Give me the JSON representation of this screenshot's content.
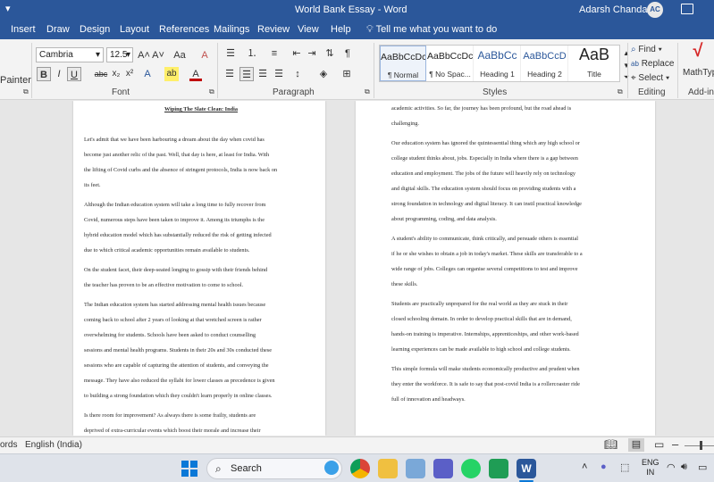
{
  "window": {
    "title": "World Bank Essay  -  Word",
    "user_name": "Adarsh Chandar",
    "user_initials": "AC"
  },
  "tabs": [
    "Insert",
    "Draw",
    "Design",
    "Layout",
    "References",
    "Mailings",
    "Review",
    "View",
    "Help"
  ],
  "tell_me": "Tell me what you want to do",
  "ribbon": {
    "clipboard": {
      "painter_label": "Painter"
    },
    "font": {
      "group_label": "Font",
      "font_name": "Cambria",
      "font_size": "12.5",
      "bold": "B",
      "italic": "I",
      "underline": "U",
      "strike": "abc",
      "subscript": "x₂",
      "superscript": "x²",
      "grow": "A˄",
      "shrink": "A˅",
      "case": "Aa",
      "clear": "A",
      "text_effects": "A",
      "highlight": "ab",
      "font_color": "A"
    },
    "paragraph": {
      "group_label": "Paragraph"
    },
    "styles": {
      "group_label": "Styles",
      "items": [
        {
          "sample": "AaBbCcDc",
          "name": "¶ Normal"
        },
        {
          "sample": "AaBbCcDc",
          "name": "¶ No Spac..."
        },
        {
          "sample": "AaBbCc",
          "name": "Heading 1"
        },
        {
          "sample": "AaBbCcD",
          "name": "Heading 2"
        },
        {
          "sample": "AaB",
          "name": "Title"
        }
      ]
    },
    "editing": {
      "group_label": "Editing",
      "find": "Find",
      "replace": "Replace",
      "select": "Select"
    },
    "addins": {
      "group_label": "Add-in",
      "mathtype": "MathType"
    }
  },
  "document": {
    "page1": {
      "heading": "Wiping The Slate Clean: India",
      "paragraphs": [
        [
          "Let's admit that we have been harbouring a dream about the day when covid has",
          "become just another relic of the past. Well, that day is here, at least for India. With",
          "the lifting of Covid curbs and the absence of stringent protocols, India is now back on",
          "its feet."
        ],
        [
          "Although the Indian education system will take a long time to fully recover from",
          "Covid, numerous steps have been taken to improve it. Among its triumphs is the",
          "hybrid education model which has substantially reduced the risk of getting infected",
          "due to which critical academic opportunities remain available to students."
        ],
        [
          "On the student facet, their deep-seated longing to gossip with their friends behind",
          "the teacher has proven to be an effective motivation to come to school."
        ],
        [
          "The Indian education system has started addressing mental health issues because",
          "coming back to school after 2 years of looking at that wretched screen is rather",
          "overwhelming for students.  Schools have been asked to conduct counselling",
          "sessions and mental health programs. Students in their 20s and 30s conducted these",
          "sessions who are capable of capturing the attention of students, and conveying the",
          "message. They have also reduced the syllabi for lower classes as precedence is given",
          "to building a strong foundation which they couldn't learn properly in online classes."
        ],
        [
          "Is there room for improvement? As always there is some frailty, students are",
          "deprived of extra-curricular events which boost their morale and increase their"
        ]
      ]
    },
    "page2": {
      "paragraphs": [
        [
          "academic activities. So far, the journey has been profound, but the road ahead is",
          "challenging."
        ],
        [
          "Our education system has ignored the quintessential thing which any high school or",
          "college student thinks about, jobs. Especially in India where there is a gap between",
          "education and employment. The jobs of the future will heavily rely on technology",
          "and digital skills. The education system should focus on providing students with a",
          "strong foundation in technology and digital literacy. It can instil practical knowledge",
          "about programming, coding, and data analysis."
        ],
        [
          "A student's ability to communicate, think critically, and persuade others is essential",
          "if he or she wishes to obtain a job in today's market. These skills are transferable to a",
          "wide range of jobs. Colleges can organise several competitions to test and improve",
          "these skills."
        ],
        [
          "Students are practically unprepared for the real world as they are stuck in their",
          "closed schooling domain. In order to develop practical skills that are in demand,",
          "hands-on training is imperative. Internships, apprenticeships, and other work-based",
          "learning experiences can be made available to high school and college students."
        ],
        [
          "This simple formula will make students economically productive and prudent when",
          "they enter the workforce. It is safe to say that post-covid India is a rollercoaster ride",
          "full of innovation and headways."
        ]
      ]
    }
  },
  "status": {
    "words": "ords",
    "language": "English (India)"
  },
  "taskbar": {
    "search_placeholder": "Search",
    "lang_line1": "ENG",
    "lang_line2": "IN"
  }
}
